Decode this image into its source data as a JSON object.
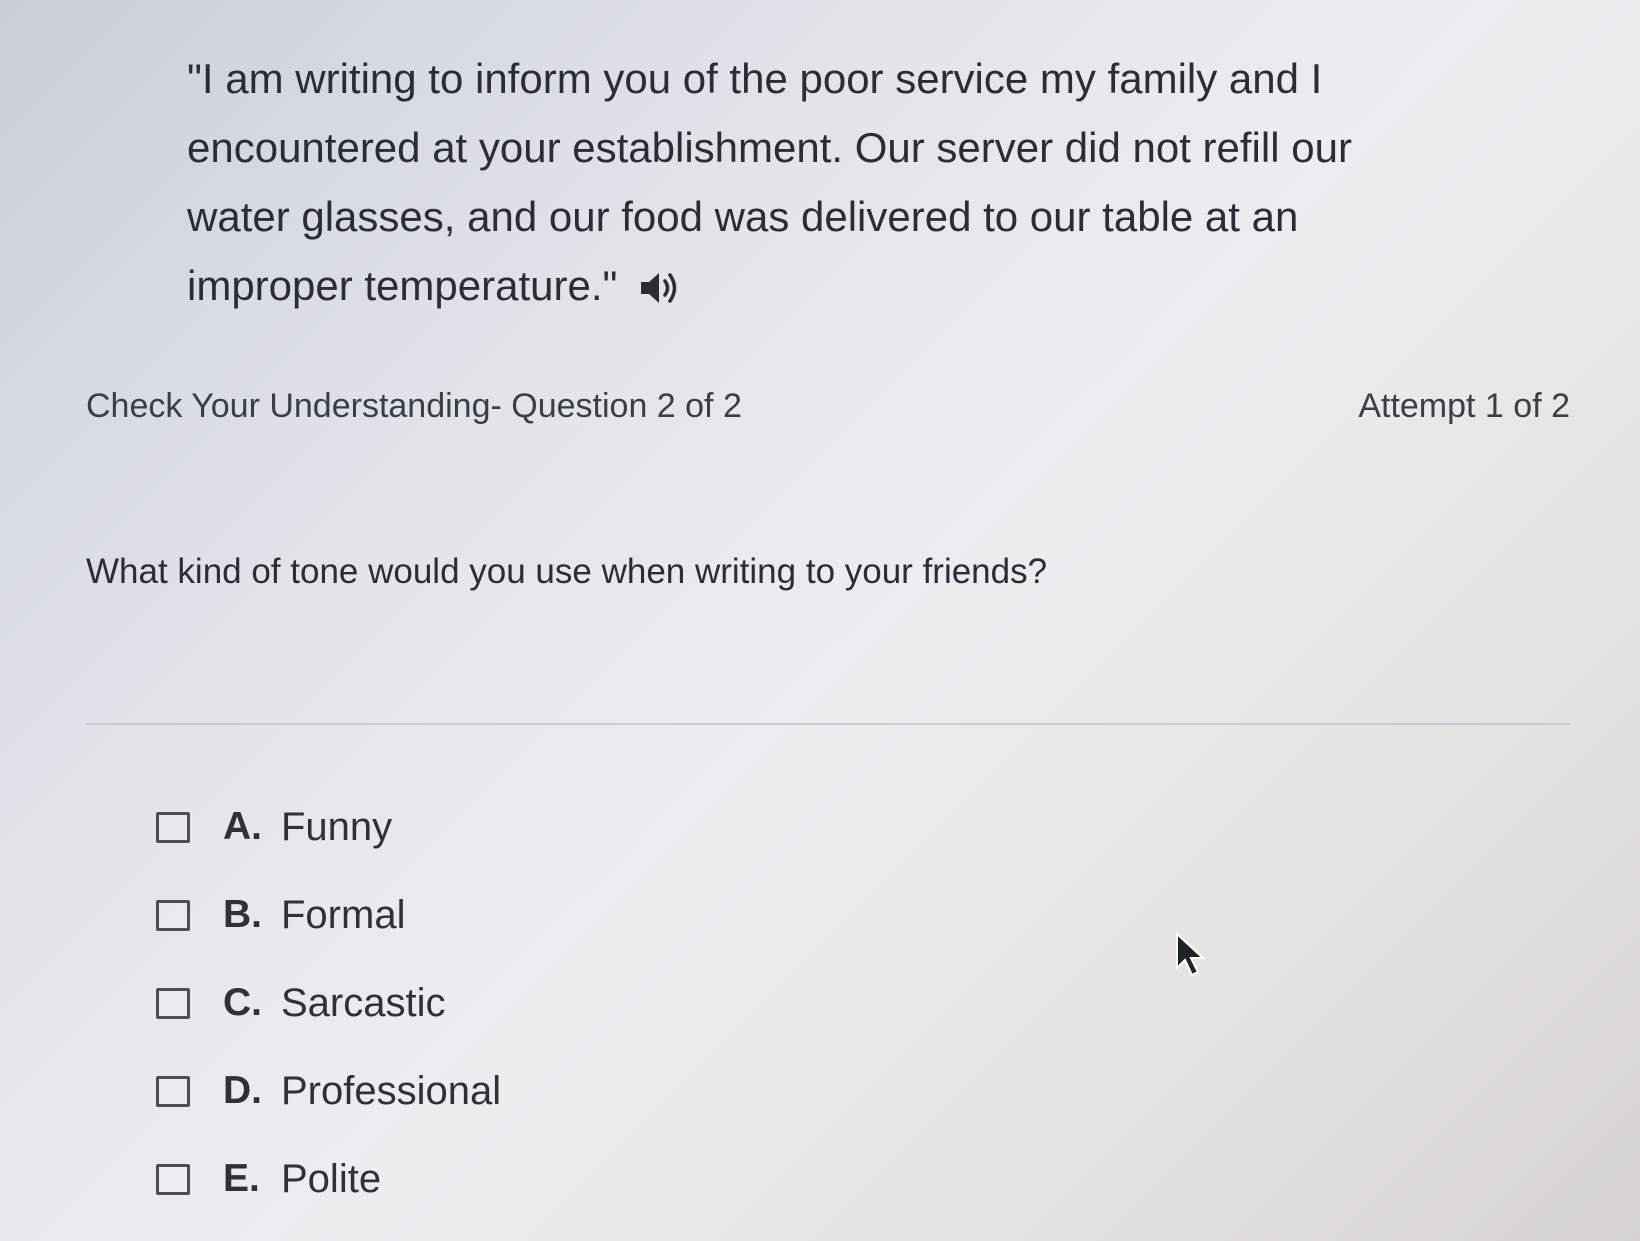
{
  "passage": {
    "text": "\"I am writing to inform you of the poor service my family and I encountered at your establishment. Our server did not refill our water glasses, and our food was delivered to our table at an improper temperature.\"",
    "audio_icon": "speaker-icon"
  },
  "header": {
    "title": "Check Your Understanding- Question 2 of 2",
    "attempt": "Attempt 1 of 2"
  },
  "question": {
    "text": "What kind of tone would you use when writing to your friends?"
  },
  "options": [
    {
      "letter": "A.",
      "text": "Funny",
      "checked": false
    },
    {
      "letter": "B.",
      "text": "Formal",
      "checked": false
    },
    {
      "letter": "C.",
      "text": "Sarcastic",
      "checked": false
    },
    {
      "letter": "D.",
      "text": "Professional",
      "checked": false
    },
    {
      "letter": "E.",
      "text": "Polite",
      "checked": false
    }
  ]
}
